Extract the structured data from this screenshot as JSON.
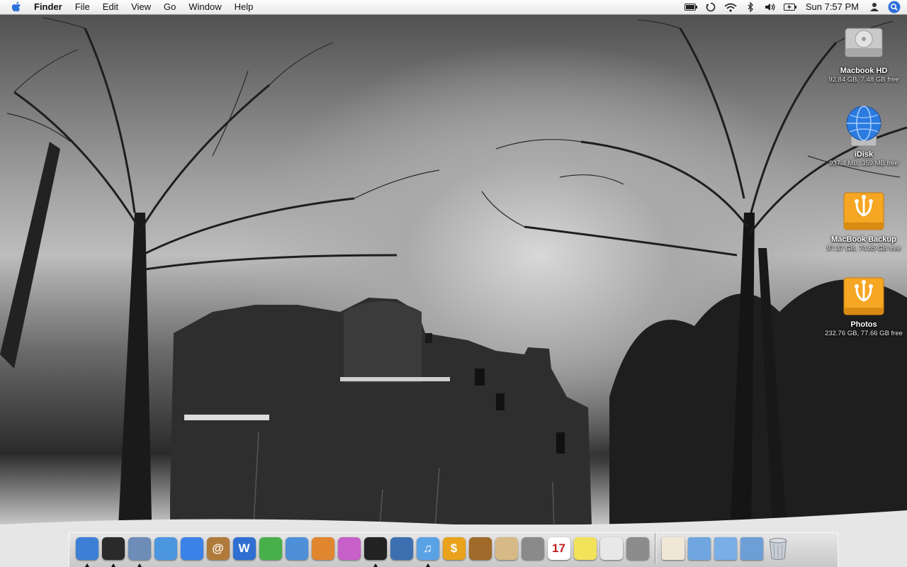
{
  "menubar": {
    "apple_icon": "apple-logo-icon",
    "app_name": "Finder",
    "menus": [
      "File",
      "Edit",
      "View",
      "Go",
      "Window",
      "Help"
    ],
    "status_icons": [
      "battery-icon",
      "time-machine-sync-icon",
      "wifi-icon",
      "bluetooth-icon",
      "volume-icon",
      "battery-charge-icon"
    ],
    "clock": "Sun 7:57 PM",
    "user_icon": "user-icon",
    "spotlight_icon": "spotlight-search-icon"
  },
  "desktop": {
    "icons": [
      {
        "name": "Macbook HD",
        "info": "92.84 GB, 7.48 GB free",
        "icon": "hard-drive-icon"
      },
      {
        "name": "iDisk",
        "info": "937.4 MB, 359 MB free",
        "icon": "idisk-globe-icon"
      },
      {
        "name": "MacBook Backup",
        "info": "97.37 GB, 74.85 GB free",
        "icon": "firewire-drive-icon"
      },
      {
        "name": "Photos",
        "info": "232.76 GB, 77.66 GB free",
        "icon": "firewire-drive-icon"
      }
    ]
  },
  "dock": {
    "apps": [
      {
        "icon": "finder-icon",
        "running": true,
        "color": "#3d7fd6",
        "glyph": ""
      },
      {
        "icon": "dashboard-icon",
        "running": true,
        "color": "#2a2a2a",
        "glyph": ""
      },
      {
        "icon": "mail-stamp-icon",
        "running": true,
        "color": "#6d8db8",
        "glyph": ""
      },
      {
        "icon": "safari-compass-icon",
        "running": false,
        "color": "#4c96e0",
        "glyph": ""
      },
      {
        "icon": "ichat-icon",
        "running": false,
        "color": "#3b82e8",
        "glyph": ""
      },
      {
        "icon": "address-book-icon",
        "running": false,
        "color": "#b07a3a",
        "glyph": "@"
      },
      {
        "icon": "word-icon",
        "running": false,
        "color": "#2f6fd1",
        "glyph": "W"
      },
      {
        "icon": "vpn-green-icon",
        "running": false,
        "color": "#47b04a",
        "glyph": ""
      },
      {
        "icon": "feather-icon",
        "running": false,
        "color": "#4d8fd8",
        "glyph": ""
      },
      {
        "icon": "iphoto-brush-icon",
        "running": false,
        "color": "#e0862f",
        "glyph": ""
      },
      {
        "icon": "butterfly-icon",
        "running": false,
        "color": "#c760c8",
        "glyph": ""
      },
      {
        "icon": "aperture-lens-icon",
        "running": true,
        "color": "#222222",
        "glyph": ""
      },
      {
        "icon": "photo-booth-icon",
        "running": false,
        "color": "#3c6fb0",
        "glyph": ""
      },
      {
        "icon": "itunes-icon",
        "running": true,
        "color": "#5aa2e6",
        "glyph": "♫"
      },
      {
        "icon": "dollar-app-icon",
        "running": false,
        "color": "#e8a21c",
        "glyph": "$"
      },
      {
        "icon": "keynote-icon",
        "running": false,
        "color": "#a06a2a",
        "glyph": ""
      },
      {
        "icon": "packager-box-icon",
        "running": false,
        "color": "#d7b987",
        "glyph": ""
      },
      {
        "icon": "dvd-player-icon",
        "running": false,
        "color": "#8a8a8a",
        "glyph": ""
      },
      {
        "icon": "ical-icon",
        "running": false,
        "color": "#ffffff",
        "glyph": "17"
      },
      {
        "icon": "stickies-icon",
        "running": false,
        "color": "#f2e35a",
        "glyph": ""
      },
      {
        "icon": "textedit-icon",
        "running": false,
        "color": "#e8e8e8",
        "glyph": ""
      },
      {
        "icon": "calculator-icon",
        "running": false,
        "color": "#8c8c8c",
        "glyph": ""
      }
    ],
    "stacks": [
      {
        "icon": "home-folder-icon",
        "color": "#f0e7d6"
      },
      {
        "icon": "applications-folder-icon",
        "color": "#6fa6e0"
      },
      {
        "icon": "documents-folder-icon",
        "color": "#79aee6"
      },
      {
        "icon": "downloads-folder-icon",
        "color": "#6d9fd6"
      }
    ],
    "trash_icon": "trash-icon"
  }
}
